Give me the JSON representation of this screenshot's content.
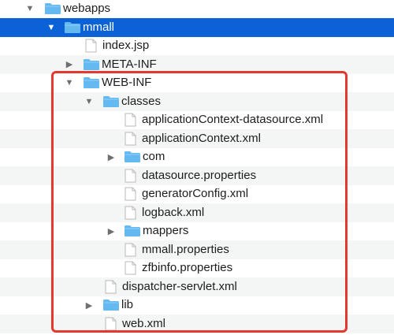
{
  "tree": [
    {
      "label": "webapps",
      "type": "folder",
      "level": 0,
      "expanded": true
    },
    {
      "label": "mmall",
      "type": "folder",
      "level": 1,
      "expanded": true,
      "selected": true
    },
    {
      "label": "index.jsp",
      "type": "file",
      "level": 2
    },
    {
      "label": "META-INF",
      "type": "folder",
      "level": 2,
      "expanded": false
    },
    {
      "label": "WEB-INF",
      "type": "folder",
      "level": 2,
      "expanded": true
    },
    {
      "label": "classes",
      "type": "folder",
      "level": 3,
      "expanded": true
    },
    {
      "label": "applicationContext-datasource.xml",
      "type": "file",
      "level": 4
    },
    {
      "label": "applicationContext.xml",
      "type": "file",
      "level": 4
    },
    {
      "label": "com",
      "type": "folder",
      "level": 4,
      "expanded": false
    },
    {
      "label": "datasource.properties",
      "type": "file",
      "level": 4
    },
    {
      "label": "generatorConfig.xml",
      "type": "file",
      "level": 4
    },
    {
      "label": "logback.xml",
      "type": "file",
      "level": 4
    },
    {
      "label": "mappers",
      "type": "folder",
      "level": 4,
      "expanded": false
    },
    {
      "label": "mmall.properties",
      "type": "file",
      "level": 4
    },
    {
      "label": "zfbinfo.properties",
      "type": "file",
      "level": 4
    },
    {
      "label": "dispatcher-servlet.xml",
      "type": "file",
      "level": 3
    },
    {
      "label": "lib",
      "type": "folder",
      "level": 3,
      "expanded": false
    },
    {
      "label": "web.xml",
      "type": "file",
      "level": 3
    }
  ],
  "colors": {
    "selection": "#0a62d6",
    "folder": "#63b9f0",
    "highlight_box": "#e5382e",
    "alt_row": "#f4f5f5"
  }
}
